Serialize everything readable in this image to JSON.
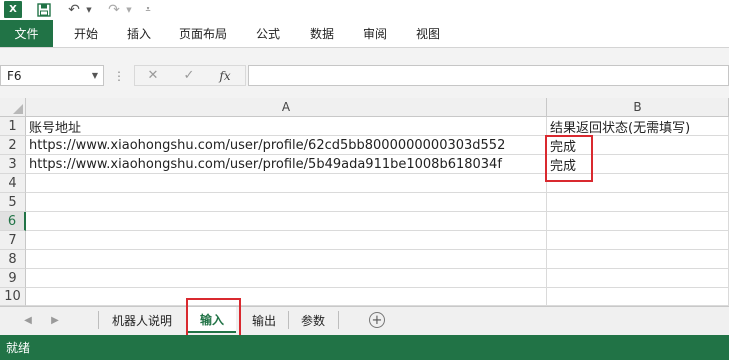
{
  "app": {
    "name": "Excel"
  },
  "quick_access": {
    "undo_icon": "undo-icon",
    "redo_icon": "redo-icon",
    "save_icon": "save-icon",
    "customize_icon": "customize-icon"
  },
  "ribbon": {
    "file": "文件",
    "tabs": [
      "开始",
      "插入",
      "页面布局",
      "公式",
      "数据",
      "审阅",
      "视图"
    ]
  },
  "formula_bar": {
    "name_box": "F6",
    "fx": "fx",
    "formula": ""
  },
  "grid": {
    "columns": [
      "A",
      "B"
    ],
    "rows": [
      "1",
      "2",
      "3",
      "4",
      "5",
      "6",
      "7",
      "8",
      "9",
      "10"
    ],
    "cells": {
      "A1": "账号地址",
      "B1": "结果返回状态(无需填写)",
      "A2": "https://www.xiaohongshu.com/user/profile/62cd5bb8000000000303d552",
      "B2": "完成",
      "A3": "https://www.xiaohongshu.com/user/profile/5b49ada911be1008b618034f",
      "B3": "完成"
    },
    "selected_row": "6"
  },
  "sheet_tabs": {
    "tabs": [
      "机器人说明",
      "输入",
      "输出",
      "参数"
    ],
    "active": "输入"
  },
  "status_bar": {
    "text": "就绪"
  },
  "colors": {
    "accent": "#217346",
    "highlight": "#d9292f"
  }
}
